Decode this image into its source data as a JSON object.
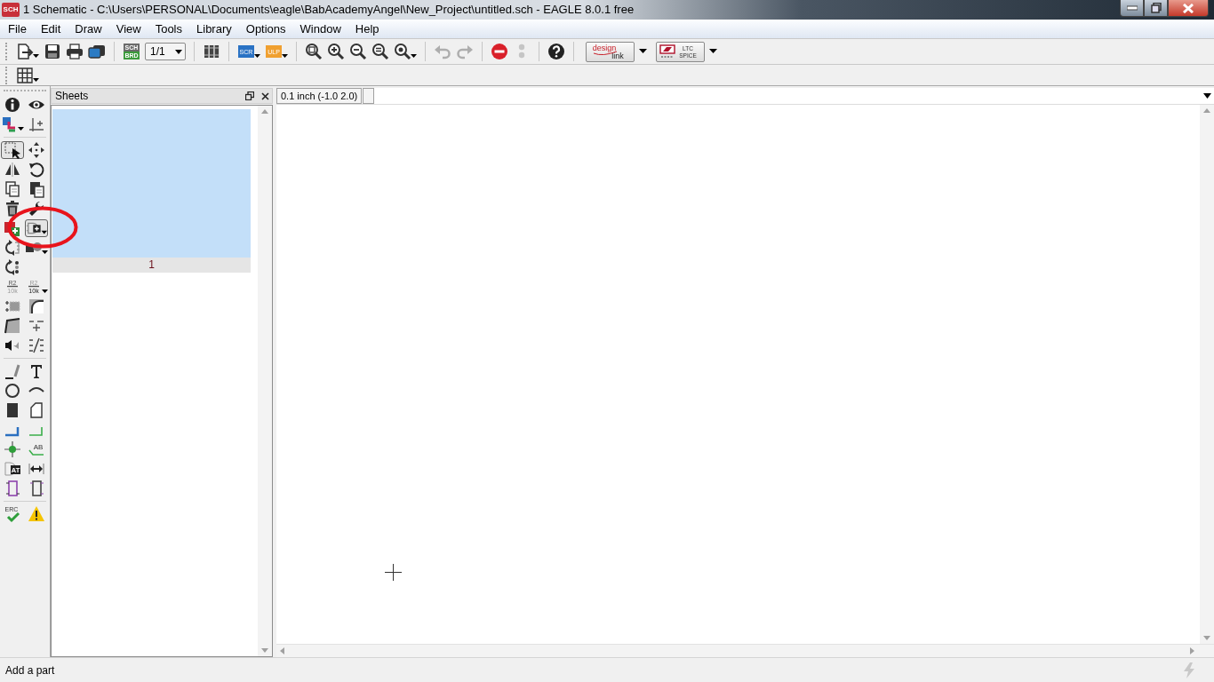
{
  "window": {
    "icon_text": "SCH",
    "title": "1 Schematic - C:\\Users\\PERSONAL\\Documents\\eagle\\BabAcademyAngel\\New_Project\\untitled.sch - EAGLE 8.0.1 free"
  },
  "menu": [
    "File",
    "Edit",
    "Draw",
    "View",
    "Tools",
    "Library",
    "Options",
    "Window",
    "Help"
  ],
  "toolbar": [
    {
      "kind": "open",
      "dropdown": true,
      "disabled": false
    },
    {
      "kind": "save",
      "disabled": false
    },
    {
      "kind": "print",
      "disabled": false
    },
    {
      "kind": "snapshot",
      "disabled": false
    },
    {
      "kind": "separator"
    },
    {
      "kind": "sch-brd",
      "text": [
        "SCH",
        "BRD"
      ],
      "disabled": false
    },
    {
      "kind": "sheet-select",
      "value": "1/1",
      "disabled": false
    },
    {
      "kind": "separator"
    },
    {
      "kind": "library",
      "disabled": false
    },
    {
      "kind": "separator"
    },
    {
      "kind": "script",
      "text": [
        "SCR"
      ],
      "dropdown": true,
      "disabled": false
    },
    {
      "kind": "ulp",
      "text": [
        "ULP"
      ],
      "dropdown": true,
      "disabled": false
    },
    {
      "kind": "separator"
    },
    {
      "kind": "zoom-fit",
      "disabled": false
    },
    {
      "kind": "zoom-in",
      "disabled": false
    },
    {
      "kind": "zoom-out",
      "disabled": false
    },
    {
      "kind": "zoom-select",
      "disabled": false
    },
    {
      "kind": "zoom-last",
      "dropdown": true,
      "disabled": false
    },
    {
      "kind": "separator"
    },
    {
      "kind": "undo",
      "disabled": true
    },
    {
      "kind": "redo",
      "disabled": true
    },
    {
      "kind": "separator"
    },
    {
      "kind": "stop",
      "disabled": false
    },
    {
      "kind": "go",
      "disabled": true
    },
    {
      "kind": "separator"
    },
    {
      "kind": "help",
      "disabled": false
    },
    {
      "kind": "separator"
    },
    {
      "kind": "design-link",
      "text": [
        "design",
        "link"
      ],
      "dropdown": true,
      "disabled": false
    },
    {
      "kind": "ltspice",
      "text": [
        "LTC",
        "SPICE"
      ],
      "dropdown": true,
      "disabled": false
    }
  ],
  "toolbar2": [
    {
      "kind": "grid",
      "dropdown": true,
      "disabled": false
    }
  ],
  "tool_groups": [
    [
      [
        {
          "kind": "info",
          "selected": false
        },
        {
          "kind": "eye",
          "selected": false
        }
      ],
      [
        {
          "kind": "layers",
          "dropdown": true,
          "selected": false
        },
        {
          "kind": "mark",
          "selected": false
        }
      ]
    ],
    [
      [
        {
          "kind": "select",
          "selected": true
        },
        {
          "kind": "move",
          "selected": false
        }
      ],
      [
        {
          "kind": "mirror",
          "selected": false
        },
        {
          "kind": "rotate",
          "selected": false
        }
      ],
      [
        {
          "kind": "copy",
          "selected": false
        },
        {
          "kind": "paste",
          "selected": false
        }
      ],
      [
        {
          "kind": "delete",
          "selected": false
        },
        {
          "kind": "wrench",
          "selected": false
        }
      ],
      [
        {
          "kind": "add",
          "selected": false
        },
        {
          "kind": "add-part",
          "dropdown": true,
          "selected": true
        }
      ],
      [
        {
          "kind": "replace",
          "selected": false
        },
        {
          "kind": "gate-swap",
          "dropdown": true,
          "selected": false
        }
      ],
      [
        {
          "kind": "pin-swap",
          "selected": false
        }
      ],
      [
        {
          "kind": "name",
          "text": [
            "R2",
            "10k"
          ],
          "selected": false
        },
        {
          "kind": "value",
          "text": [
            "R2",
            "10k"
          ],
          "dropdown": true,
          "selected": false
        }
      ],
      [
        {
          "kind": "smash",
          "selected": false
        },
        {
          "kind": "miter",
          "selected": false
        }
      ],
      [
        {
          "kind": "split",
          "selected": false
        },
        {
          "kind": "optimize",
          "selected": false
        }
      ],
      [
        {
          "kind": "invoke",
          "selected": false
        },
        {
          "kind": "slice",
          "selected": false
        }
      ]
    ],
    [
      [
        {
          "kind": "line",
          "selected": false
        },
        {
          "kind": "text",
          "selected": false
        }
      ],
      [
        {
          "kind": "circle",
          "selected": false
        },
        {
          "kind": "arc",
          "selected": false
        }
      ],
      [
        {
          "kind": "rect",
          "selected": false
        },
        {
          "kind": "polygon",
          "selected": false
        }
      ],
      [
        {
          "kind": "wire",
          "selected": false
        },
        {
          "kind": "net",
          "selected": false
        }
      ],
      [
        {
          "kind": "junction",
          "selected": false
        },
        {
          "kind": "label",
          "text": [
            "AB"
          ],
          "selected": false
        }
      ],
      [
        {
          "kind": "attribute",
          "text": [
            "AT"
          ],
          "selected": false
        },
        {
          "kind": "dimension",
          "selected": false
        }
      ],
      [
        {
          "kind": "frame",
          "selected": false
        },
        {
          "kind": "frame-alt",
          "selected": false
        }
      ]
    ],
    [
      [
        {
          "kind": "erc",
          "text": [
            "ERC"
          ],
          "selected": false
        },
        {
          "kind": "errors",
          "selected": false
        }
      ]
    ]
  ],
  "sheets": {
    "title": "Sheets",
    "items": [
      {
        "label": "1",
        "selected": true
      }
    ]
  },
  "coordinates": "0.1 inch (-1.0 2.0)",
  "annotations": [
    {
      "kind": "ellipse"
    }
  ],
  "status_bar": {
    "message": "Add a part"
  }
}
